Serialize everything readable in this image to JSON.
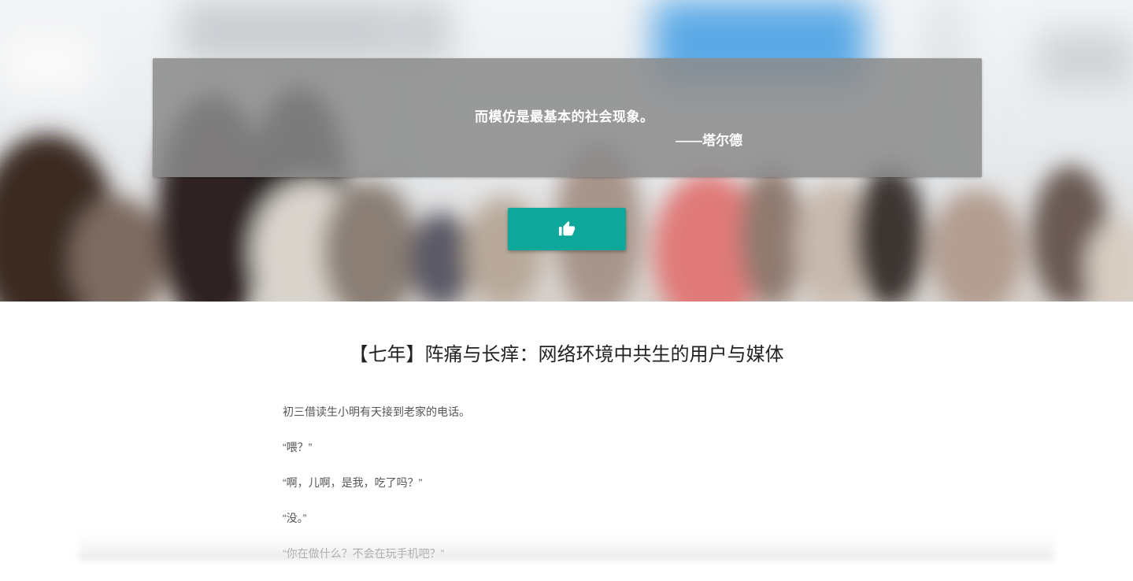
{
  "hero": {
    "quote": "而模仿是最基本的社会现象。",
    "author": "——塔尔德",
    "like_icon": "thumbs-up-icon",
    "button_color": "#0ea89b"
  },
  "article": {
    "title": "【七年】阵痛与长痒：网络环境中共生的用户与媒体",
    "paragraphs": [
      "初三借读生小明有天接到老家的电话。",
      "“喂？”",
      "“啊，儿啊，是我，吃了吗？”",
      "“没。”",
      "“你在做什么？不会在玩手机吧？”"
    ]
  }
}
